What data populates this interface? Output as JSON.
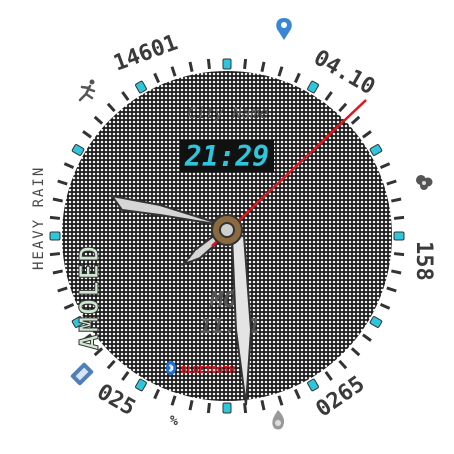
{
  "watchface": {
    "steps": "14601",
    "date": "04.10",
    "weather_text": "HEAVY RAIN",
    "brand": "AMOLED",
    "city": "City Name",
    "time": "21:29",
    "weekday": "MON",
    "day_month": "11.01",
    "bluetooth_label": "BLUETOOTH",
    "battery": "025",
    "battery_unit": "%",
    "calories": "0265",
    "heart_rate": "158",
    "accent_color": "#2ec6dc",
    "second_hand_color": "#e0141e",
    "icons": {
      "steps": "running-person-icon",
      "location": "location-pin-icon",
      "weather": "weather-cloud-icon",
      "battery": "battery-icon",
      "calories": "flame-icon",
      "bluetooth": "bluetooth-icon"
    }
  }
}
